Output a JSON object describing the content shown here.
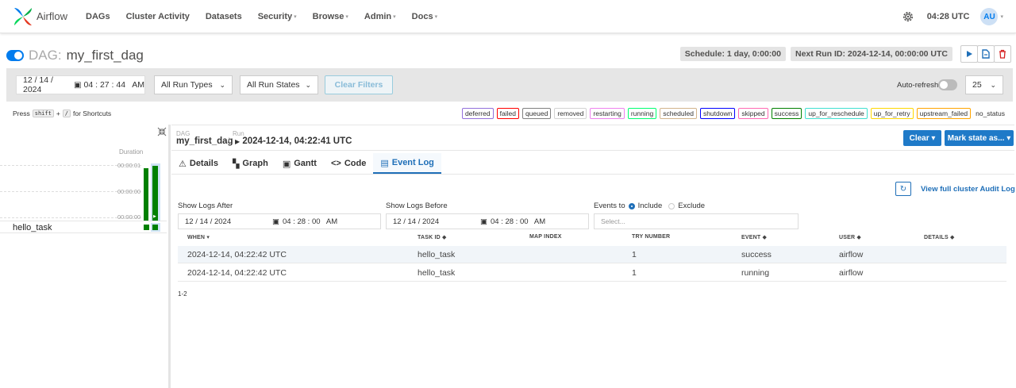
{
  "nav": {
    "brand": "Airflow",
    "items": [
      {
        "label": "DAGs",
        "caret": false
      },
      {
        "label": "Cluster Activity",
        "caret": false
      },
      {
        "label": "Datasets",
        "caret": false
      },
      {
        "label": "Security",
        "caret": true
      },
      {
        "label": "Browse",
        "caret": true
      },
      {
        "label": "Admin",
        "caret": true
      },
      {
        "label": "Docs",
        "caret": true
      }
    ],
    "time": "04:28 UTC",
    "avatar": "AU"
  },
  "dag": {
    "prefix": "DAG:",
    "name": "my_first_dag",
    "schedule": "Schedule: 1 day, 0:00:00",
    "next_run": "Next Run ID: 2024-12-14, 00:00:00 UTC"
  },
  "filters": {
    "date": "12 / 14 / 2024",
    "time": "04 : 27 : 44   AM",
    "run_types": "All Run Types",
    "run_states": "All Run States",
    "clear_filters": "Clear Filters",
    "autorefresh": "Auto-refresh",
    "page_size": "25"
  },
  "shortcuts": {
    "press": "Press",
    "key1": "shift",
    "plus": "+",
    "key2": "/",
    "suffix": "for Shortcuts"
  },
  "legend": [
    {
      "label": "deferred",
      "color": "#9370db"
    },
    {
      "label": "failed",
      "color": "#ff0000"
    },
    {
      "label": "queued",
      "color": "#808080"
    },
    {
      "label": "removed",
      "color": "#d3d3d3"
    },
    {
      "label": "restarting",
      "color": "#ee82ee"
    },
    {
      "label": "running",
      "color": "#01ff70"
    },
    {
      "label": "scheduled",
      "color": "#d2b48c"
    },
    {
      "label": "shutdown",
      "color": "#0000ff"
    },
    {
      "label": "skipped",
      "color": "#ff69b4"
    },
    {
      "label": "success",
      "color": "#008000"
    },
    {
      "label": "up_for_reschedule",
      "color": "#40e0d0"
    },
    {
      "label": "up_for_retry",
      "color": "#ffd700"
    },
    {
      "label": "upstream_failed",
      "color": "#ffa500"
    }
  ],
  "legend_plain": "no_status",
  "grid": {
    "duration_label": "Duration",
    "ticks": [
      "00:00:01",
      "00:00:00",
      "00:00:00"
    ],
    "task": "hello_task"
  },
  "breadcrumb": {
    "dag_label": "DAG",
    "dag_value": "my_first_dag",
    "sep": "/",
    "run_label": "Run",
    "run_value": "2024-12-14, 04:22:41 UTC"
  },
  "actions": {
    "clear": "Clear ▾",
    "mark_state": "Mark state as... ▾"
  },
  "tabs": [
    {
      "icon": "⚠",
      "label": "Details",
      "active": false
    },
    {
      "icon": "▚",
      "label": "Graph",
      "active": false
    },
    {
      "icon": "▣",
      "label": "Gantt",
      "active": false
    },
    {
      "icon": "<>",
      "label": "Code",
      "active": false
    },
    {
      "icon": "▤",
      "label": "Event Log",
      "active": true
    }
  ],
  "eventlog": {
    "audit_link": "View full cluster Audit Log",
    "after_label": "Show Logs After",
    "before_label": "Show Logs Before",
    "after_date": "12 / 14 / 2024",
    "after_time": "04 : 28 : 00   AM",
    "before_date": "12 / 14 / 2024",
    "before_time": "04 : 28 : 00   AM",
    "events_to": "Events to",
    "include": "Include",
    "exclude": "Exclude",
    "select_placeholder": "Select...",
    "columns": [
      "WHEN ▾",
      "TASK ID ◆",
      "MAP INDEX",
      "TRY NUMBER",
      "EVENT ◆",
      "USER ◆",
      "DETAILS ◆"
    ],
    "rows": [
      [
        "2024-12-14, 04:22:42 UTC",
        "hello_task",
        "",
        "1",
        "success",
        "airflow",
        ""
      ],
      [
        "2024-12-14, 04:22:42 UTC",
        "hello_task",
        "",
        "1",
        "running",
        "airflow",
        ""
      ]
    ],
    "pager": "1-2"
  }
}
